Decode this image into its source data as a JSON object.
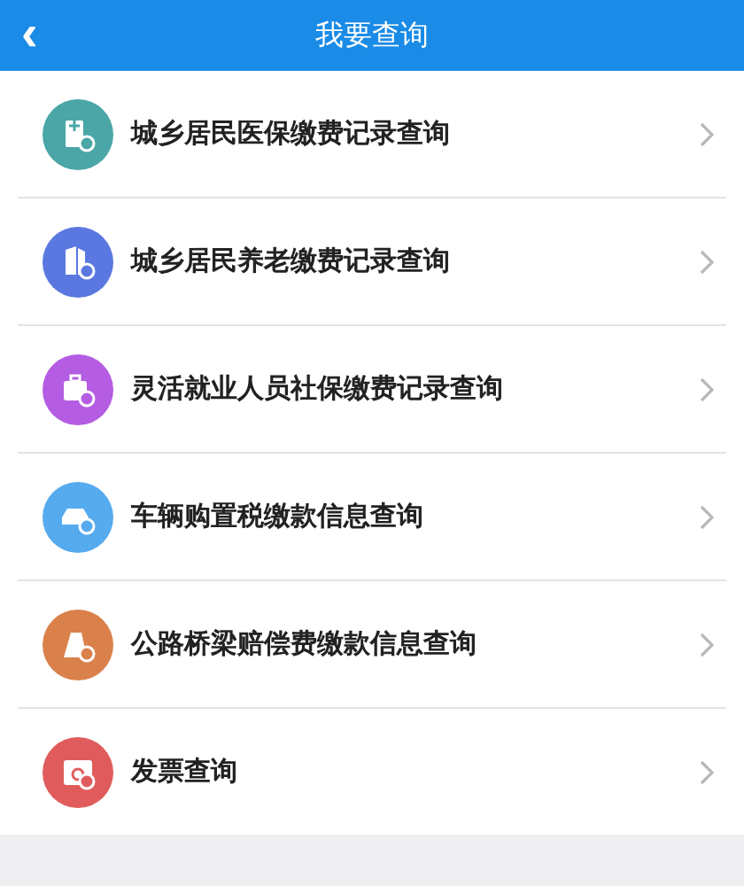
{
  "header": {
    "back": "‹",
    "title": "我要查询"
  },
  "items": [
    {
      "label": "城乡居民医保缴费记录查询",
      "kind": "medical",
      "color": "#4ba6a7"
    },
    {
      "label": "城乡居民养老缴费记录查询",
      "kind": "building",
      "color": "#5a78e0"
    },
    {
      "label": "灵活就业人员社保缴费记录查询",
      "kind": "briefcase",
      "color": "#b45de2"
    },
    {
      "label": "车辆购置税缴款信息查询",
      "kind": "car",
      "color": "#56aaee"
    },
    {
      "label": "公路桥梁赔偿费缴款信息查询",
      "kind": "road",
      "color": "#da814b"
    },
    {
      "label": "发票查询",
      "kind": "calendar",
      "color": "#e05c5c"
    }
  ]
}
